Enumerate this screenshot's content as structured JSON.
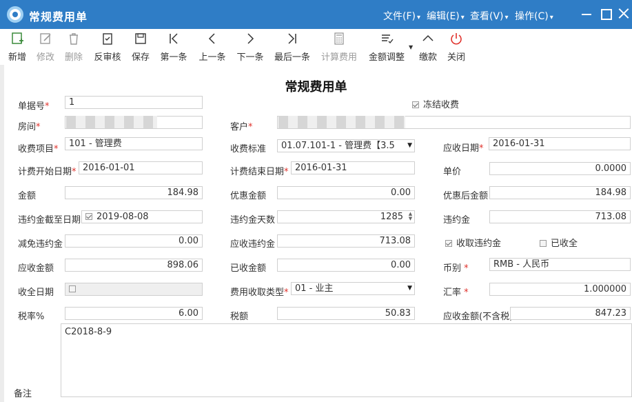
{
  "window": {
    "title": "常规费用单",
    "menus": [
      "文件(F)",
      "编辑(E)",
      "查看(V)",
      "操作(C)"
    ]
  },
  "toolbar": {
    "new": "新增",
    "edit": "修改",
    "delete": "删除",
    "unaudit": "反审核",
    "save": "保存",
    "first": "第一条",
    "prev": "上一条",
    "next": "下一条",
    "last": "最后一条",
    "calc_fee": "计算费用",
    "amount_adjust": "金额调整",
    "pay": "缴款",
    "close": "关闭"
  },
  "form": {
    "title": "常规费用单",
    "doc_no_label": "单据号",
    "doc_no": "1",
    "freeze_label": "冻结收费",
    "freeze_checked": true,
    "room_label": "房间",
    "customer_label": "客户",
    "fee_item_label": "收费项目",
    "fee_item": "101 - 管理费",
    "fee_std_label": "收费标准",
    "fee_std": "01.07.101-1 - 管理费【3.5",
    "due_date_label": "应收日期",
    "due_date": "2016-01-31",
    "start_date_label": "计费开始日期",
    "start_date": "2016-01-01",
    "end_date_label": "计费结束日期",
    "end_date": "2016-01-31",
    "unit_price_label": "单价",
    "unit_price": "0.0000",
    "amount_label": "金额",
    "amount": "184.98",
    "discount_label": "优惠金额",
    "discount": "0.00",
    "after_discount_label": "优惠后金额",
    "after_discount": "184.98",
    "penalty_until_label": "违约金截至日期",
    "penalty_until": "2019-08-08",
    "penalty_days_label": "违约金天数",
    "penalty_days": "1285",
    "penalty_label": "违约金",
    "penalty": "713.08",
    "penalty_waive_label": "减免违约金",
    "penalty_waive": "0.00",
    "penalty_due_label": "应收违约金",
    "penalty_due": "713.08",
    "collect_penalty_label": "收取违约金",
    "collected_label": "已收全",
    "receivable_label": "应收金额",
    "receivable": "898.06",
    "received_label": "已收金额",
    "received": "0.00",
    "currency_label": "币别",
    "currency": "RMB - 人民币",
    "receive_date_label": "收全日期",
    "fee_type_label": "费用收取类型",
    "fee_type": "01 - 业主",
    "rate_label": "汇率",
    "rate": "1.000000",
    "tax_rate_label": "税率%",
    "tax_rate": "6.00",
    "tax_label": "税额",
    "tax": "50.83",
    "net_receivable_label": "应收金额(不含税)",
    "net_receivable": "847.23",
    "remark_label": "备注",
    "remark": "C2018-8-9"
  }
}
